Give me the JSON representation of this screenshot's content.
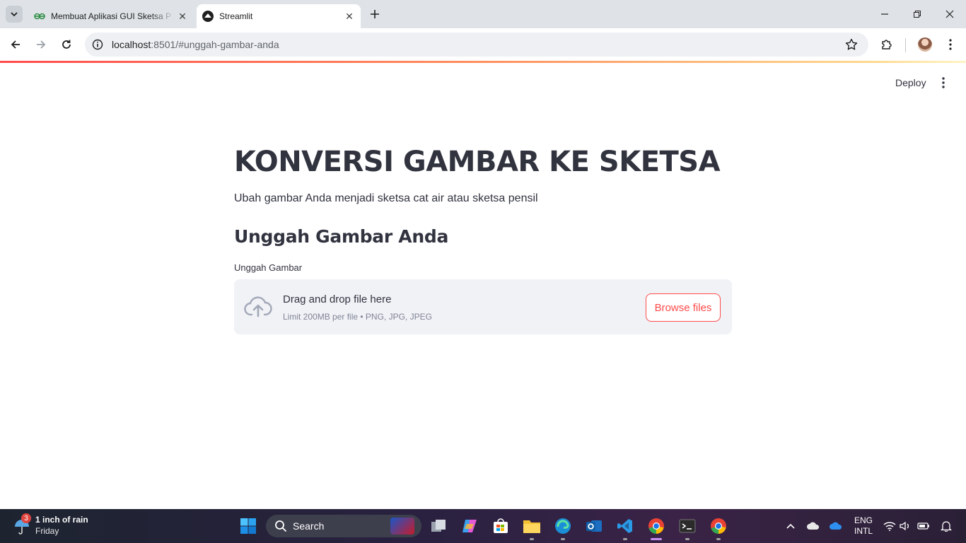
{
  "browser": {
    "tabs": [
      {
        "title": "Membuat Aplikasi GUI Sketsa P",
        "active": false,
        "favicon": "geeksforgeeks-icon"
      },
      {
        "title": "Streamlit",
        "active": true,
        "favicon": "streamlit-icon"
      }
    ],
    "address": {
      "host": "localhost",
      "path": ":8501/#unggah-gambar-anda"
    }
  },
  "app": {
    "toolbar": {
      "deploy_label": "Deploy"
    },
    "title": "KONVERSI GAMBAR KE SKETSA",
    "subtitle": "Ubah gambar Anda menjadi sketsa cat air atau sketsa pensil",
    "section_heading": "Unggah Gambar Anda",
    "uploader": {
      "label": "Unggah Gambar",
      "drop_text": "Drag and drop file here",
      "limit_text": "Limit 200MB per file • PNG, JPG, JPEG",
      "browse_label": "Browse files"
    },
    "colors": {
      "primary": "#ff4b4b",
      "text": "#31333f",
      "dropzone_bg": "#f0f2f6"
    }
  },
  "taskbar": {
    "weather": {
      "badge": "3",
      "line1": "1 inch of rain",
      "line2": "Friday"
    },
    "search_label": "Search",
    "language": {
      "line1": "ENG",
      "line2": "INTL"
    }
  }
}
